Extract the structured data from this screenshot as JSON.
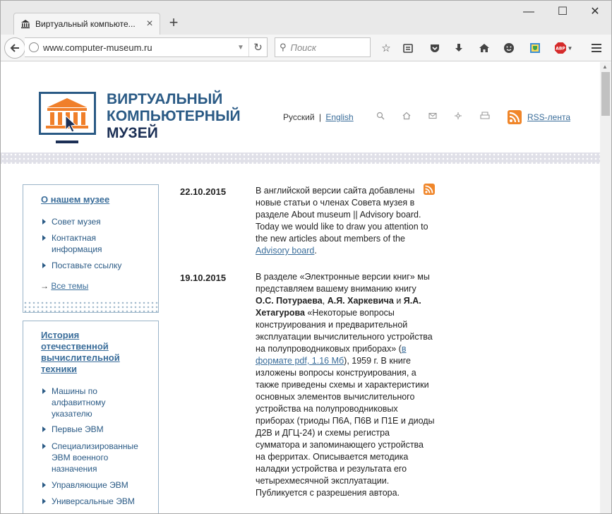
{
  "browser": {
    "tab_title": "Виртуальный компьюте...",
    "url": "www.computer-museum.ru",
    "search_placeholder": "Поиск",
    "abp": "ABP"
  },
  "site": {
    "logo_line1": "ВИРТУАЛЬНЫЙ",
    "logo_line2": "КОМПЬЮТЕРНЫЙ",
    "logo_line3": "МУЗЕЙ",
    "lang_ru": "Русский",
    "lang_sep": "|",
    "lang_en": "English",
    "rss_label": "RSS-лента"
  },
  "sidebar": {
    "box1": {
      "heading": "О нашем музее",
      "items": [
        "Совет музея",
        "Контактная информация",
        "Поставьте ссылку"
      ],
      "all_arrow": "→",
      "all_label": "Все темы"
    },
    "box2": {
      "heading": "История отечественной вычислительной техники",
      "items": [
        "Машины по алфавитному указателю",
        "Первые ЭВМ",
        "Специализированные ЭВМ военного назначения",
        "Управляющие ЭВМ",
        "Универсальные ЭВМ"
      ]
    }
  },
  "news": [
    {
      "date": "22.10.2015",
      "text_before": "В английской версии сайта добавлены новые статьи о членах Совета музея в разделе About museum || Advisory board. Today we would like to draw you attention to the new articles about members of the",
      "link": "Advisory board",
      "text_after": "."
    },
    {
      "date": "19.10.2015",
      "p1": "В разделе «Электронные версии книг» мы представляем вашему вниманию книгу",
      "a1": "О.С. Потураева",
      "sep1": ",",
      "a2": "А.Я. Харкевича",
      "sep2": "и",
      "a3": "Я.А. Хетагурова",
      "p2": "«Некоторые вопросы конструирования и предварительной эксплуатации вычислительного устройства на полупроводниковых приборах» (",
      "link": "в формате pdf, 1.16 Мб",
      "p3": "), 1959 г. В книге изложены вопросы конструирования, а также приведены схемы и характеристики основных элементов вычислительного устройства на полупроводниковых приборах (триоды П6А, П6В и П1Е и диоды Д2В и ДГЦ-24) и схемы регистра сумматора и запоминающего устройства на ферритах. Описывается методика наладки устройства и результата его четырехмесячной эксплуатации. Публикуется с разрешения автора."
    }
  ]
}
